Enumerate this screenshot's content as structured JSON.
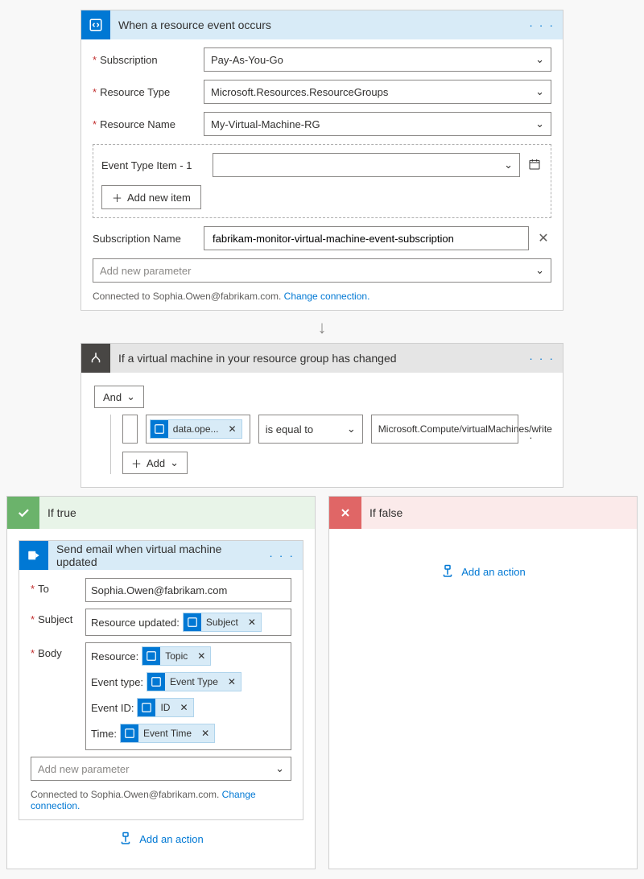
{
  "trigger": {
    "title": "When a resource event occurs",
    "fields": {
      "subscription_label": "Subscription",
      "subscription_value": "Pay-As-You-Go",
      "resource_type_label": "Resource Type",
      "resource_type_value": "Microsoft.Resources.ResourceGroups",
      "resource_name_label": "Resource Name",
      "resource_name_value": "My-Virtual-Machine-RG",
      "event_type_item_label": "Event Type Item - 1",
      "event_type_item_value": "",
      "add_new_item": "Add new item",
      "subscription_name_label": "Subscription Name",
      "subscription_name_value": "fabrikam-monitor-virtual-machine-event-subscription",
      "add_new_parameter": "Add new parameter"
    },
    "connection": {
      "prefix": "Connected to ",
      "email": "Sophia.Owen@fabrikam.com.",
      "change": "Change connection."
    }
  },
  "condition": {
    "title": "If a virtual machine in your resource group has changed",
    "group_op": "And",
    "row": {
      "left_token": "data.ope...",
      "op": "is equal to",
      "right": "Microsoft.Compute/virtualMachines/write"
    },
    "add": "Add"
  },
  "if_true": {
    "title": "If true",
    "email": {
      "title": "Send email when virtual machine updated",
      "to_label": "To",
      "to_value": "Sophia.Owen@fabrikam.com",
      "subject_label": "Subject",
      "subject_prefix": "Resource updated:",
      "subject_token": "Subject",
      "body_label": "Body",
      "body_lines": {
        "resource_label": "Resource:",
        "resource_token": "Topic",
        "event_type_label": "Event type:",
        "event_type_token": "Event Type",
        "event_id_label": "Event ID:",
        "event_id_token": "ID",
        "time_label": "Time:",
        "time_token": "Event Time"
      },
      "add_new_parameter": "Add new parameter",
      "connection": {
        "prefix": "Connected to ",
        "email": "Sophia.Owen@fabrikam.com.",
        "change": "Change connection."
      }
    },
    "add_action": "Add an action"
  },
  "if_false": {
    "title": "If false",
    "add_action": "Add an action"
  }
}
